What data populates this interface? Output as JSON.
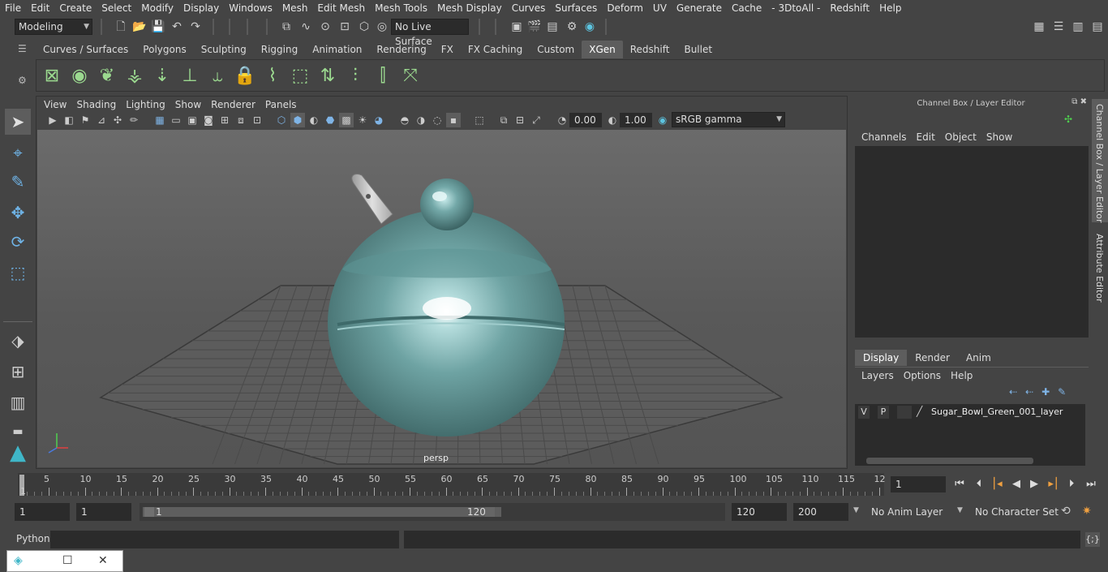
{
  "menubar": [
    "File",
    "Edit",
    "Create",
    "Select",
    "Modify",
    "Display",
    "Windows",
    "Mesh",
    "Edit Mesh",
    "Mesh Tools",
    "Mesh Display",
    "Curves",
    "Surfaces",
    "Deform",
    "UV",
    "Generate",
    "Cache",
    "- 3DtoAll -",
    "Redshift",
    "Help"
  ],
  "status": {
    "mode": "Modeling",
    "live_surface": "No Live Surface"
  },
  "shelf_tabs": [
    "Curves / Surfaces",
    "Polygons",
    "Sculpting",
    "Rigging",
    "Animation",
    "Rendering",
    "FX",
    "FX Caching",
    "Custom",
    "XGen",
    "Redshift",
    "Bullet"
  ],
  "active_shelf_tab": "XGen",
  "panel_menu": [
    "View",
    "Shading",
    "Lighting",
    "Show",
    "Renderer",
    "Panels"
  ],
  "viewport": {
    "camera_label": "persp",
    "exposure": "0.00",
    "gamma": "1.00",
    "color_space": "sRGB gamma"
  },
  "channel_box": {
    "title": "Channel Box / Layer Editor",
    "menu": [
      "Channels",
      "Edit",
      "Object",
      "Show"
    ],
    "layer_tabs": [
      "Display",
      "Render",
      "Anim"
    ],
    "active_layer_tab": "Display",
    "layer_menu": [
      "Layers",
      "Options",
      "Help"
    ],
    "layer": {
      "v": "V",
      "p": "P",
      "name": "Sugar_Bowl_Green_001_layer"
    }
  },
  "side_tabs": [
    "Channel Box / Layer Editor",
    "Attribute Editor"
  ],
  "timeline": {
    "ticks": [
      "5",
      "10",
      "15",
      "20",
      "25",
      "30",
      "35",
      "40",
      "45",
      "50",
      "55",
      "60",
      "65",
      "70",
      "75",
      "80",
      "85",
      "90",
      "95",
      "100",
      "105",
      "110",
      "115",
      "12"
    ],
    "start_label": "1",
    "current_frame": "1"
  },
  "range": {
    "start": "1",
    "start2": "1",
    "slider_start": "1",
    "slider_end": "120",
    "end": "120",
    "max": "200",
    "anim_layer": "No Anim Layer",
    "char_set": "No Character Set"
  },
  "command": {
    "language": "Python"
  },
  "colors": {
    "accent": "#5d5d5d",
    "bowl": "#6ea3a3",
    "shelf_icon": "#9bd98f",
    "tool_icon": "#6fb3e6"
  }
}
